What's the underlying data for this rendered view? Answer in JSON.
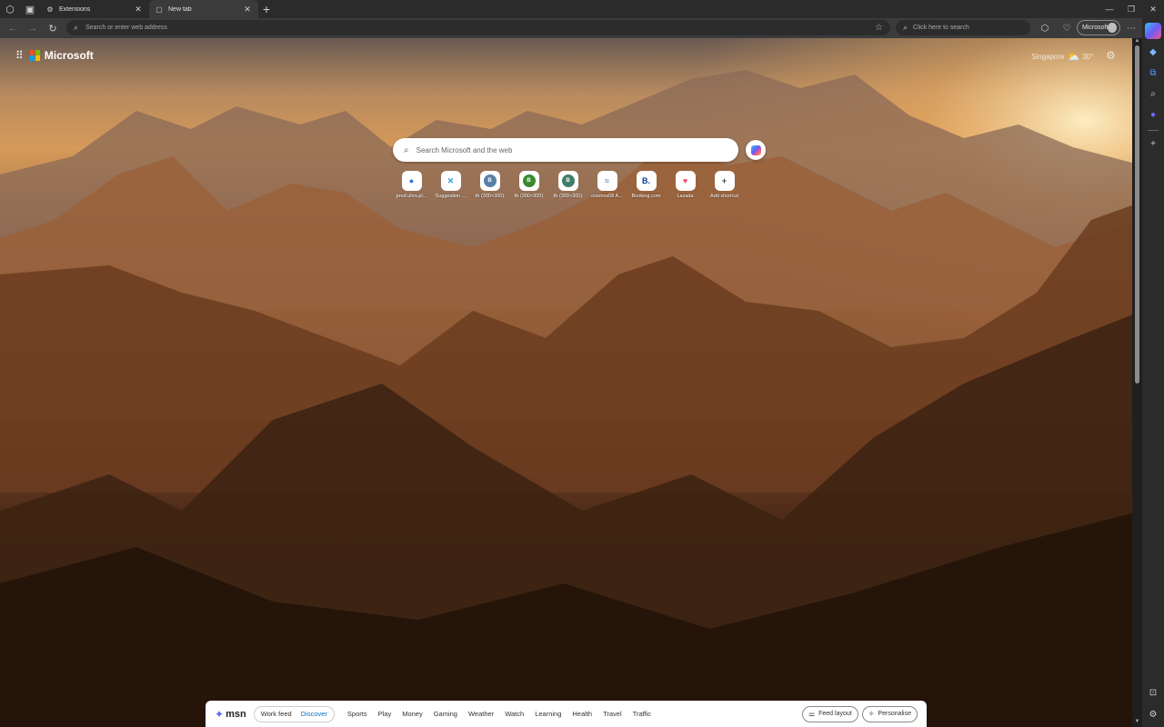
{
  "tabs": [
    {
      "label": "Extensions",
      "icon": "puzzle-icon",
      "active": false
    },
    {
      "label": "New tab",
      "icon": "page-icon",
      "active": true
    }
  ],
  "toolbar": {
    "address_placeholder": "Search or enter web address",
    "web_search_placeholder": "Click here to search",
    "profile_label": "Microsoft"
  },
  "brand": {
    "name": "Microsoft"
  },
  "weather": {
    "location": "Singapore",
    "temperature": "30°"
  },
  "search": {
    "placeholder": "Search Microsoft and the web"
  },
  "shortcuts": [
    {
      "label": "prod.uhrs.pl...",
      "glyph": "●",
      "color": "#2f6fe0"
    },
    {
      "label": "Suggestion ...",
      "glyph": "✕",
      "color": "#2b9fd8"
    },
    {
      "label": "th (300×300)",
      "glyph": "B",
      "color": "#5a7fa6"
    },
    {
      "label": "th (300×300)",
      "glyph": "B",
      "color": "#3b8a2e"
    },
    {
      "label": "th (300×300)",
      "glyph": "B",
      "color": "#3f7e6a"
    },
    {
      "label": "cosmos08 A...",
      "glyph": "≈",
      "color": "#6b8fc2"
    },
    {
      "label": "Booking.com",
      "glyph": "B.",
      "color": "#0b3d91"
    },
    {
      "label": "Lazada",
      "glyph": "♥",
      "color": "#f4456d"
    },
    {
      "label": "Add shortcut",
      "glyph": "+",
      "color": "#444444"
    }
  ],
  "msn": {
    "logo": "msn",
    "feed_tabs": [
      "Work feed",
      "Discover"
    ],
    "selected_feed": "Discover",
    "nav": [
      "Sports",
      "Play",
      "Money",
      "Gaming",
      "Weather",
      "Watch",
      "Learning",
      "Health",
      "Travel",
      "Traffic"
    ],
    "feed_layout_label": "Feed layout",
    "personalise_label": "Personalise"
  },
  "colors": {
    "accent": "#0f6cbd",
    "ms_red": "#f25022",
    "ms_green": "#7fba00",
    "ms_blue": "#00a4ef",
    "ms_yellow": "#ffb900"
  }
}
